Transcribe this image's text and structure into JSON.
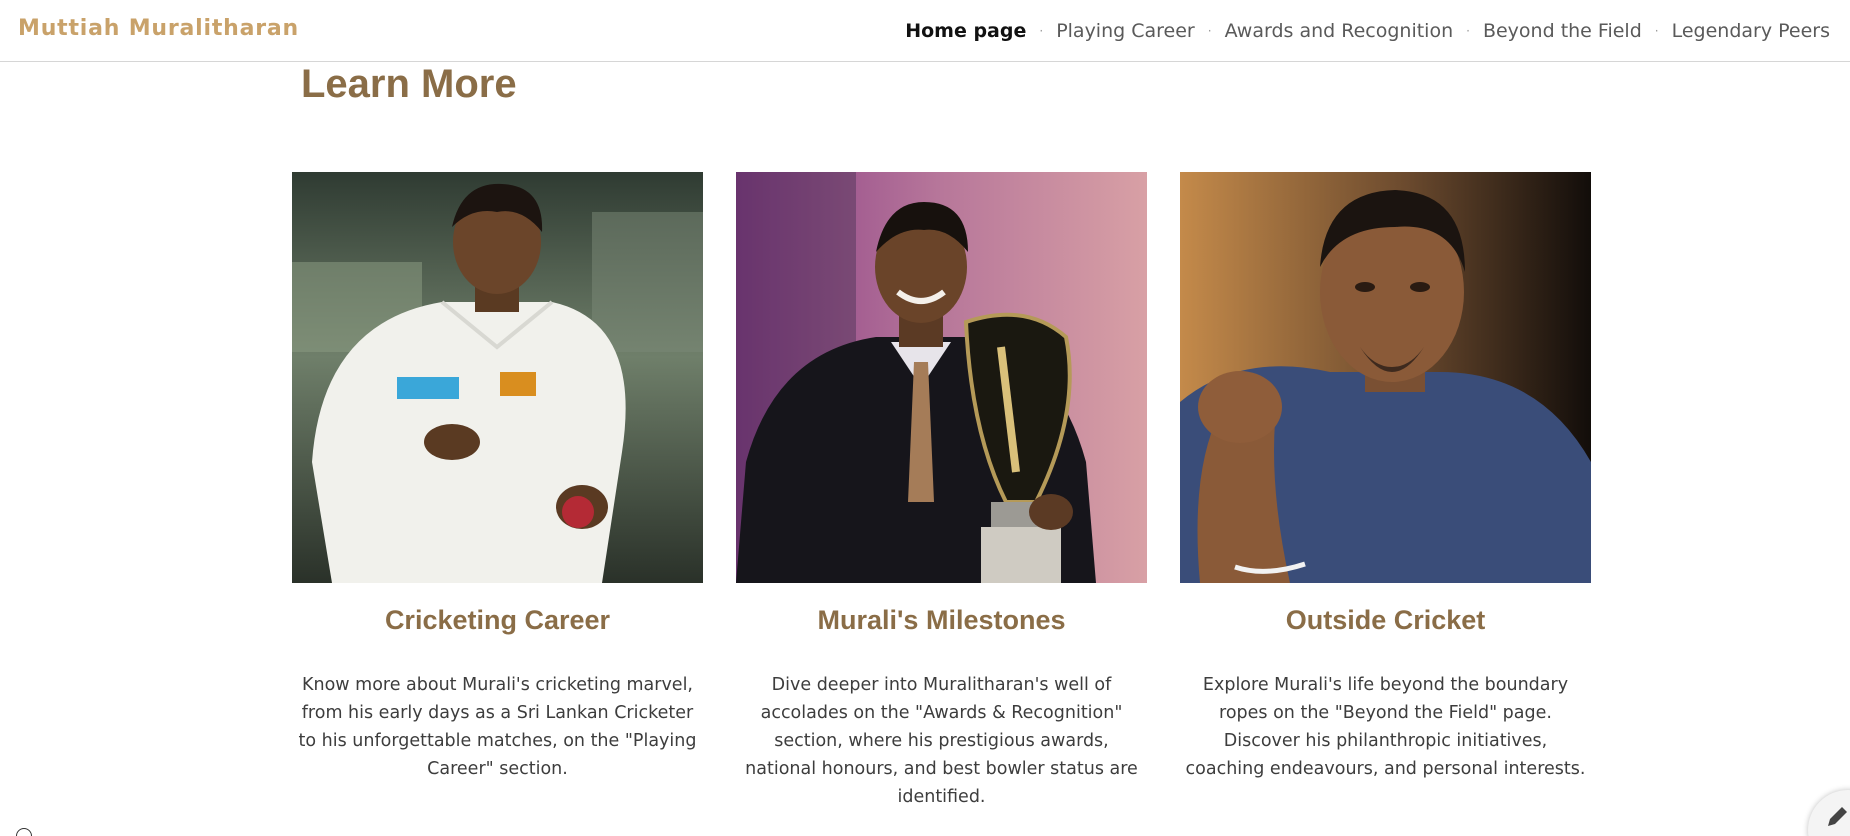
{
  "header": {
    "site_title": "Muttiah Muralitharan",
    "nav": [
      {
        "label": "Home page",
        "active": true
      },
      {
        "label": "Playing Career",
        "active": false
      },
      {
        "label": "Awards and Recognition",
        "active": false
      },
      {
        "label": "Beyond the Field",
        "active": false
      },
      {
        "label": "Legendary Peers",
        "active": false
      }
    ],
    "separator": "·"
  },
  "section": {
    "title": "Learn More"
  },
  "cards": [
    {
      "title": "Cricketing Career",
      "text": "Know more about Murali's cricketing marvel, from his early days as a Sri Lankan Cricketer to his unforgettable matches, on the \"Playing Career\" section.",
      "image_icon": "cricketer-photo"
    },
    {
      "title": "Murali's Milestones",
      "text": "Dive deeper into Muralitharan's well of accolades on the \"Awards & Recognition\" section, where his prestigious awards, national honours, and best bowler status are identified.",
      "image_icon": "trophy-photo"
    },
    {
      "title": "Outside Cricket",
      "text": "Explore Murali's life beyond the boundary ropes on the \"Beyond the Field\" page. Discover his philanthropic initiatives, coaching endeavours, and personal interests.",
      "image_icon": "portrait-photo"
    }
  ],
  "colors": {
    "brand": "#c9a26a",
    "heading": "#8a6d47",
    "body_text": "#3d3d3d"
  }
}
